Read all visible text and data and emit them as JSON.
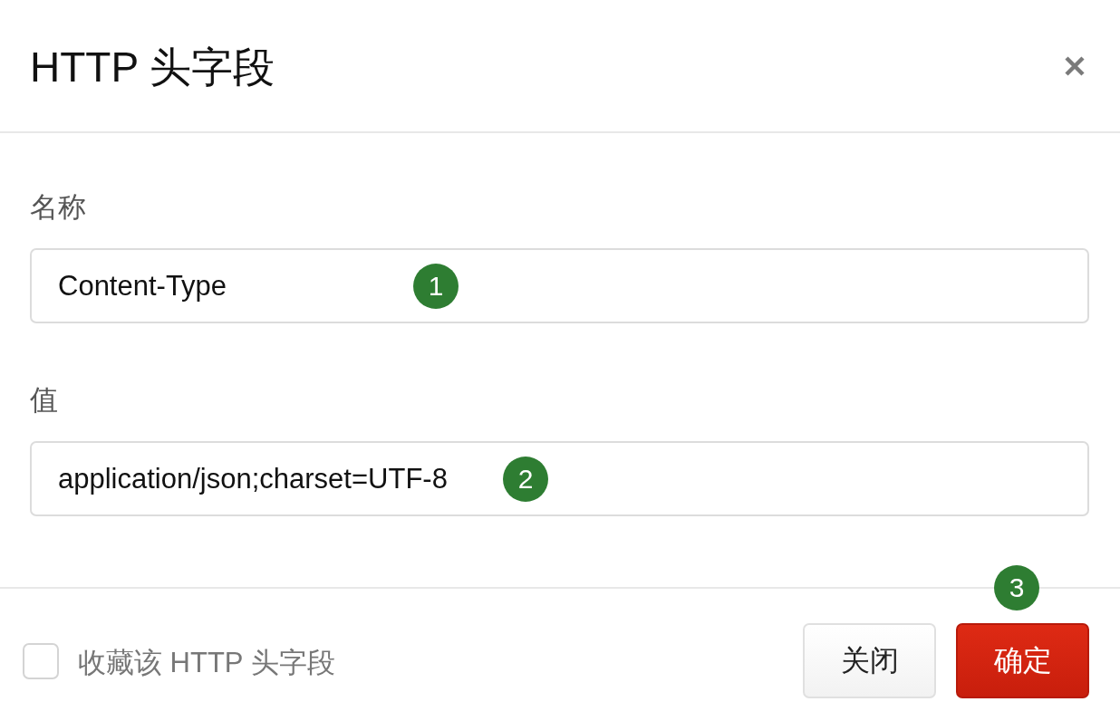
{
  "dialog": {
    "title": "HTTP 头字段"
  },
  "fields": [
    {
      "label": "名称",
      "value": "Content-Type",
      "marker": "1"
    },
    {
      "label": "值",
      "value": "application/json;charset=UTF-8",
      "marker": "2"
    }
  ],
  "footer": {
    "checkbox": {
      "label": "收藏该 HTTP 头字段",
      "checked": false
    },
    "buttons": [
      {
        "label": "关闭",
        "kind": "secondary"
      },
      {
        "label": "确定",
        "kind": "primary",
        "marker": "3"
      }
    ]
  }
}
